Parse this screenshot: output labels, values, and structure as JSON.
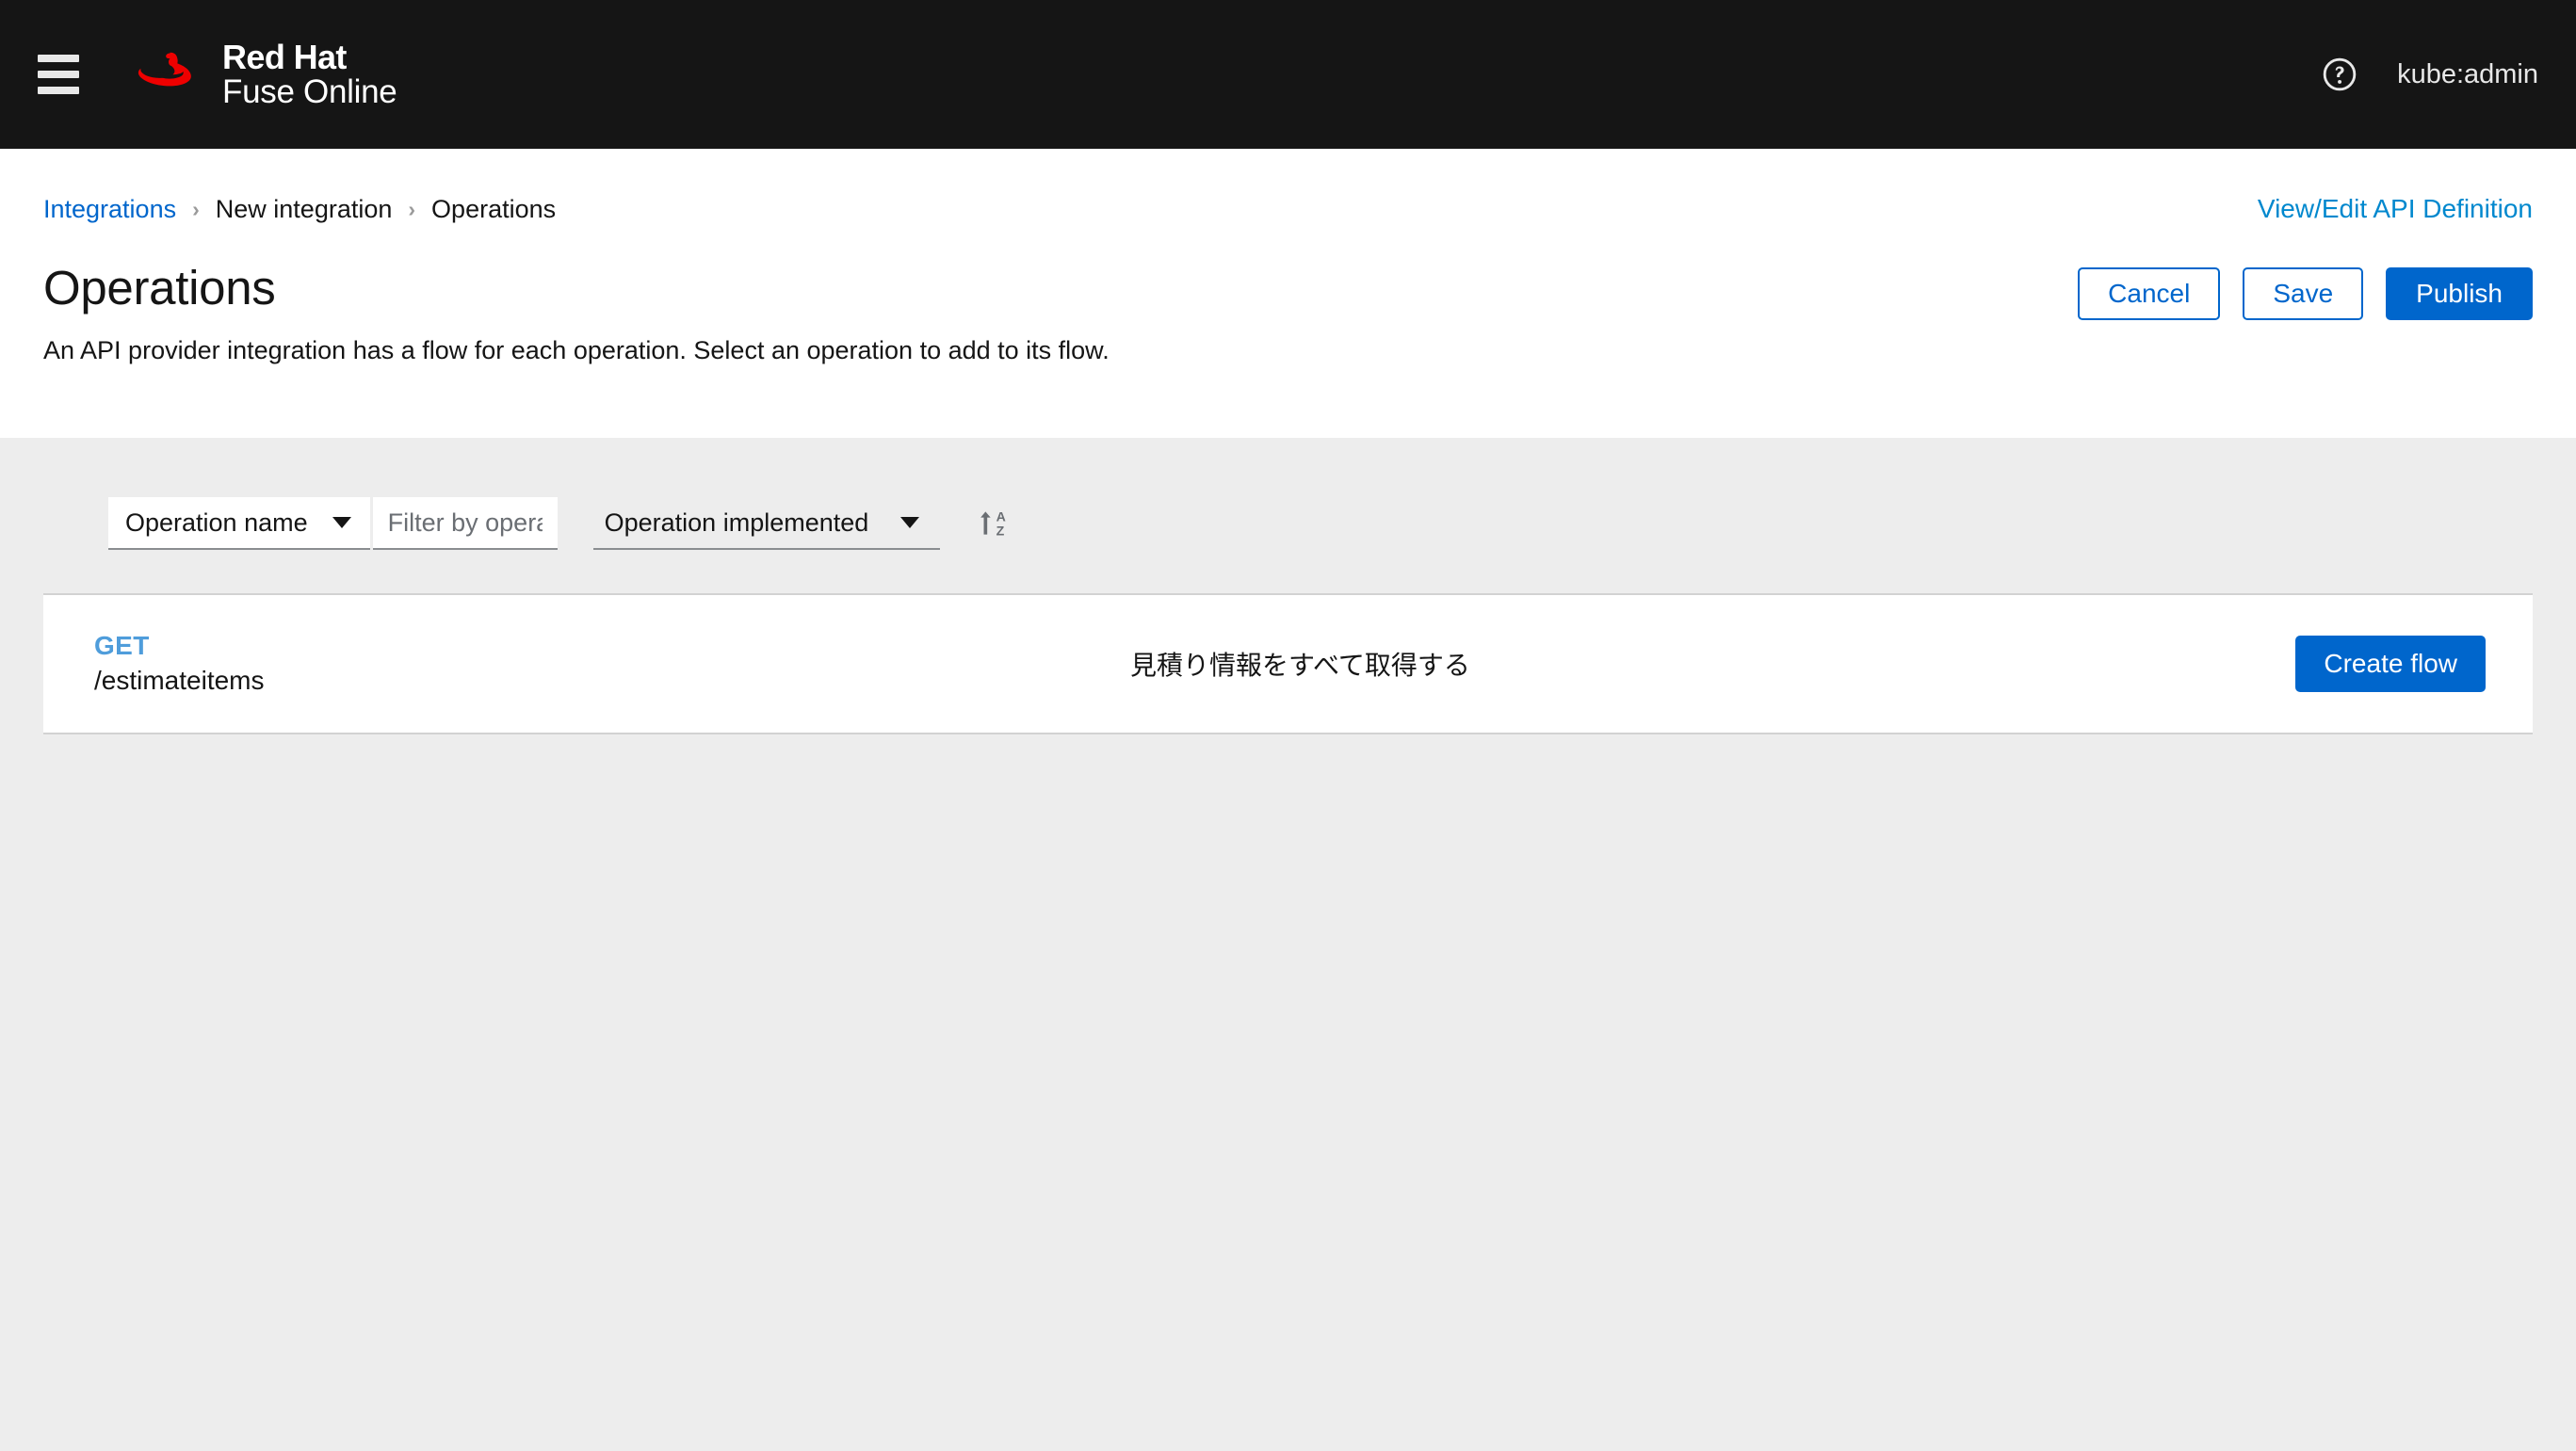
{
  "masthead": {
    "nav_toggle_label": "Global navigation",
    "brand_line1": "Red Hat",
    "brand_line2": "Fuse Online",
    "help_icon": "help-circle-icon",
    "username": "kube:admin"
  },
  "breadcrumb": {
    "items": [
      {
        "label": "Integrations",
        "link": true
      },
      {
        "label": "New integration",
        "link": false
      },
      {
        "label": "Operations",
        "link": false
      }
    ],
    "separator": "›"
  },
  "header": {
    "api_definition_link": "View/Edit API Definition",
    "title": "Operations",
    "description": "An API provider integration has a flow for each operation. Select an operation to add to its flow.",
    "actions": {
      "cancel": "Cancel",
      "save": "Save",
      "publish": "Publish"
    }
  },
  "toolbar": {
    "filter_field": {
      "selected": "Operation name",
      "caret_icon": "chevron-down-icon"
    },
    "filter_input": {
      "value": "",
      "placeholder": "Filter by operation na..."
    },
    "implemented_filter": {
      "selected": "Operation implemented",
      "caret_icon": "chevron-down-icon"
    },
    "sort": {
      "icon": "sort-alpha-asc-icon",
      "label": "Sort A to Z"
    }
  },
  "operations": {
    "rows": [
      {
        "verb": "GET",
        "path": "/estimateitems",
        "summary": "見積り情報をすべて取得する",
        "action_label": "Create flow"
      }
    ]
  },
  "colors": {
    "masthead_bg": "#151515",
    "page_bg": "#ededed",
    "card_bg": "#ffffff",
    "primary_blue": "#0066cc",
    "link_blue": "#0088ce",
    "verb_blue": "#4f9ddb",
    "brand_red": "#ee0000",
    "border_gray": "#d2d2d2"
  }
}
